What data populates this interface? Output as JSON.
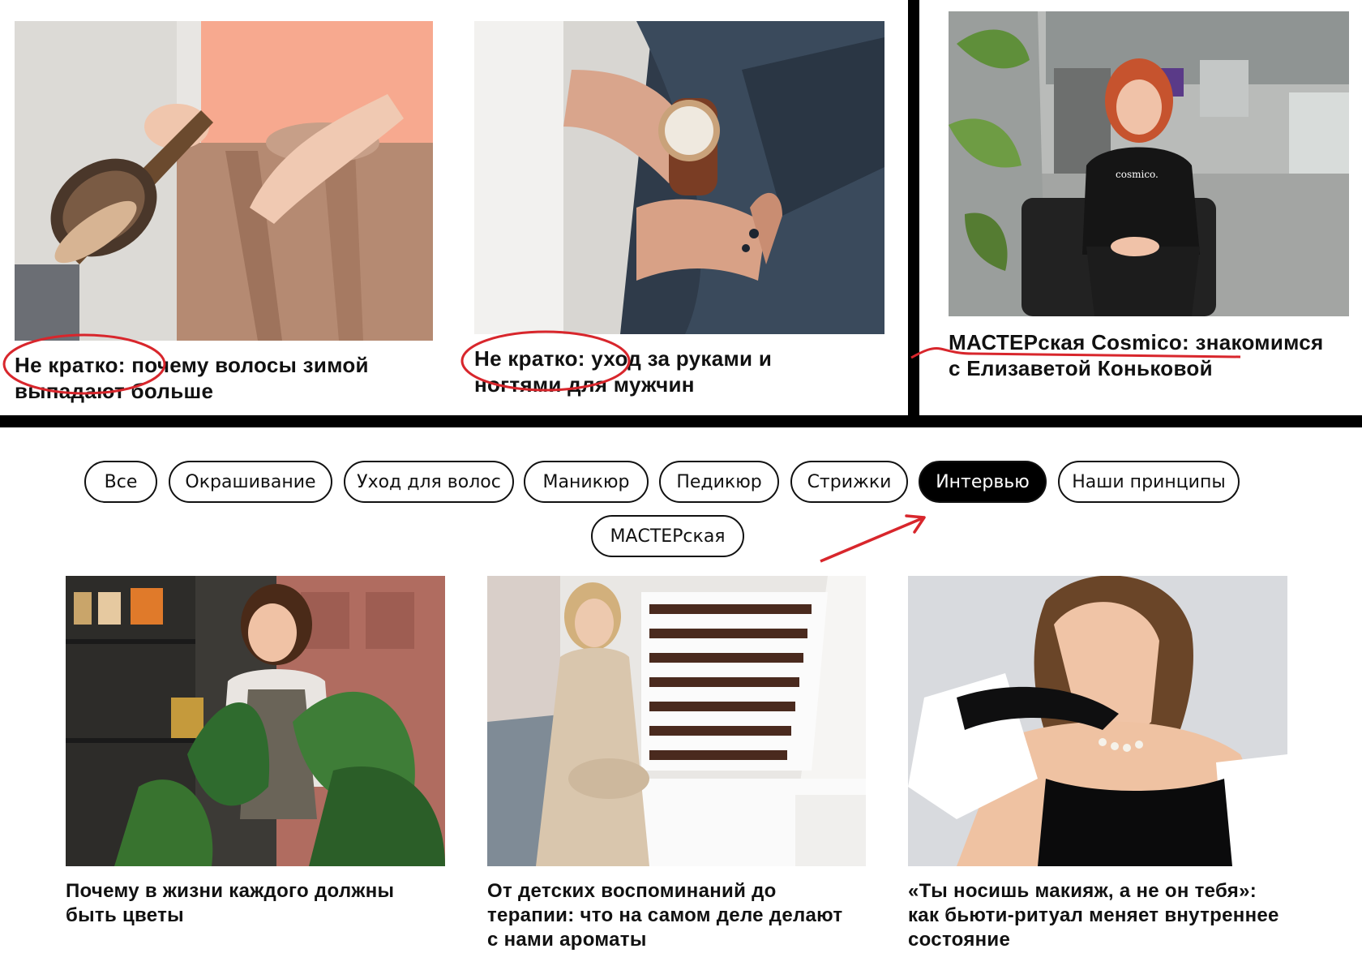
{
  "top_articles": [
    {
      "title": "Не кратко: почему волосы зимой выпадают больше"
    },
    {
      "title": "Не кратко: уход за руками и ногтями для мужчин"
    },
    {
      "title": "МАСТЕРская Cosmico: знакомимся с Елизаветой Коньковой"
    }
  ],
  "filters": {
    "items": [
      {
        "label": "Все"
      },
      {
        "label": "Окрашивание"
      },
      {
        "label": "Уход для волос"
      },
      {
        "label": "Маникюр"
      },
      {
        "label": "Педикюр"
      },
      {
        "label": "Стрижки"
      },
      {
        "label": "Интервью",
        "active": true
      },
      {
        "label": "Наши принципы"
      },
      {
        "label": "МАСТЕРская"
      }
    ]
  },
  "articles": [
    {
      "title": "Почему в жизни каждого должны быть цветы"
    },
    {
      "title": "От детских воспоминаний до терапии: что на самом деле делают с нами ароматы"
    },
    {
      "title": "«Ты носишь макияж, а не он тебя»: как бьюти-ритуал меняет внутреннее состояние"
    }
  ],
  "photo_labels": {
    "tshirt": "cosmico."
  },
  "colors": {
    "annotation_red": "#d8262c",
    "accent_black": "#000000"
  }
}
